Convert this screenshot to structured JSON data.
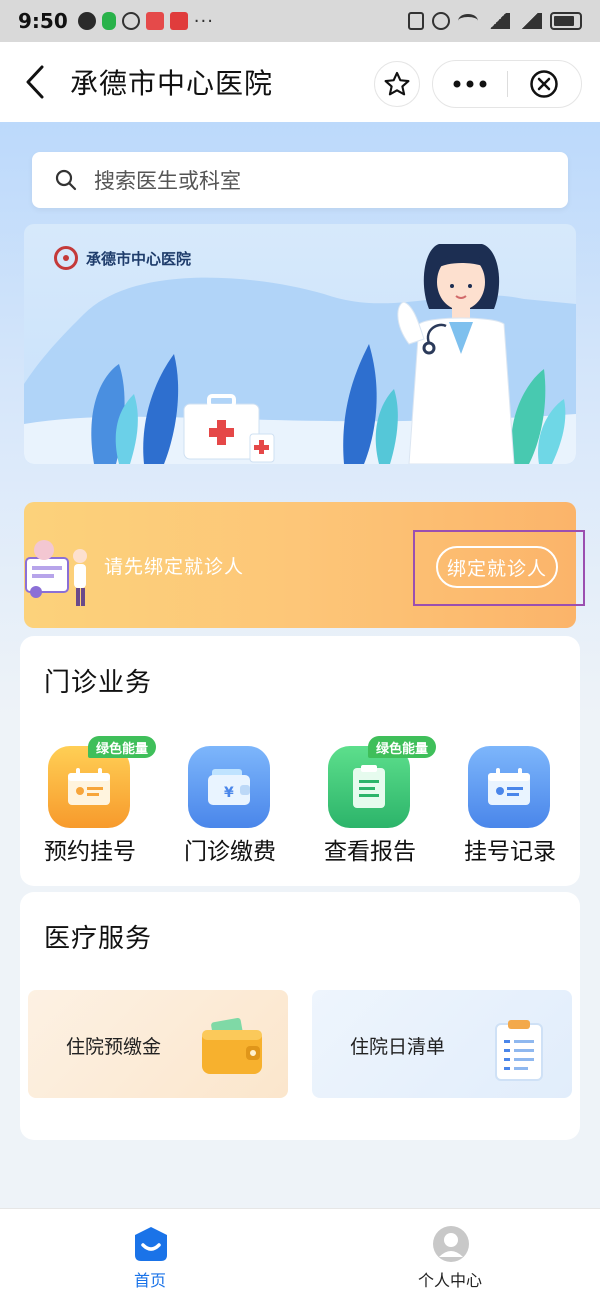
{
  "status_bar": {
    "time": "9:50",
    "more": "···"
  },
  "nav": {
    "title": "承德市中心医院"
  },
  "search": {
    "placeholder": "搜索医生或科室"
  },
  "banner": {
    "hospital_name": "承德市中心医院"
  },
  "bind": {
    "hint": "请先绑定就诊人",
    "button_label": "绑定就诊人"
  },
  "outpatient": {
    "title": "门诊业务",
    "services": [
      {
        "label": "预约挂号",
        "badge": "绿色能量",
        "icon": "calendar-card-icon",
        "color": "#fbb444"
      },
      {
        "label": "门诊缴费",
        "badge": "",
        "icon": "wallet-yuan-icon",
        "color": "#5f9bf2"
      },
      {
        "label": "查看报告",
        "badge": "绿色能量",
        "icon": "report-icon",
        "color": "#42c56f"
      },
      {
        "label": "挂号记录",
        "badge": "",
        "icon": "calendar-card-icon",
        "color": "#5f9bf2"
      }
    ]
  },
  "medical": {
    "title": "医疗服务",
    "items": [
      {
        "label": "住院预缴金",
        "icon": "wallet-icon"
      },
      {
        "label": "住院日清单",
        "icon": "clipboard-list-icon"
      }
    ]
  },
  "tabs": [
    {
      "label": "首页",
      "icon": "home-icon",
      "active": true
    },
    {
      "label": "个人中心",
      "icon": "user-icon",
      "active": false
    }
  ],
  "colors": {
    "accent": "#1a73e8",
    "bind_card": "#fcc978",
    "badge_green": "#3fbf5a",
    "highlight": "#9b4fb0"
  }
}
